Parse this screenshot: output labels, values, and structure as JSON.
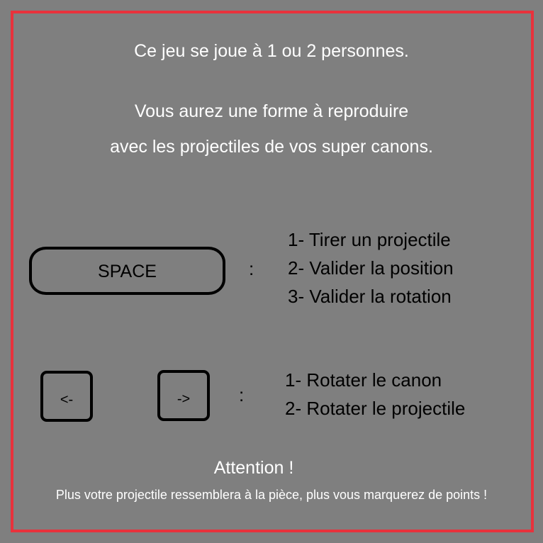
{
  "colors": {
    "background": "#7f7f7f",
    "frame_border": "#e8323c",
    "heading_text": "#ffffff",
    "instruction_text": "#000000"
  },
  "intro": {
    "players": "Ce jeu se joue à 1 ou 2 personnes.",
    "goal_line1": "Vous aurez une forme à reproduire",
    "goal_line2": "avec les projectiles de vos super canons."
  },
  "controls": {
    "space": {
      "key_label": "SPACE",
      "separator": ":",
      "actions": [
        "1- Tirer un projectile",
        "2- Valider la position",
        "3- Valider la rotation"
      ]
    },
    "arrows": {
      "left_key_label": "<-",
      "right_key_label": "->",
      "separator": ":",
      "actions": [
        "1- Rotater le canon",
        "2- Rotater le projectile"
      ]
    }
  },
  "warning": {
    "title": "Attention !",
    "message": "Plus votre projectile ressemblera à la pièce, plus vous marquerez de points !"
  }
}
